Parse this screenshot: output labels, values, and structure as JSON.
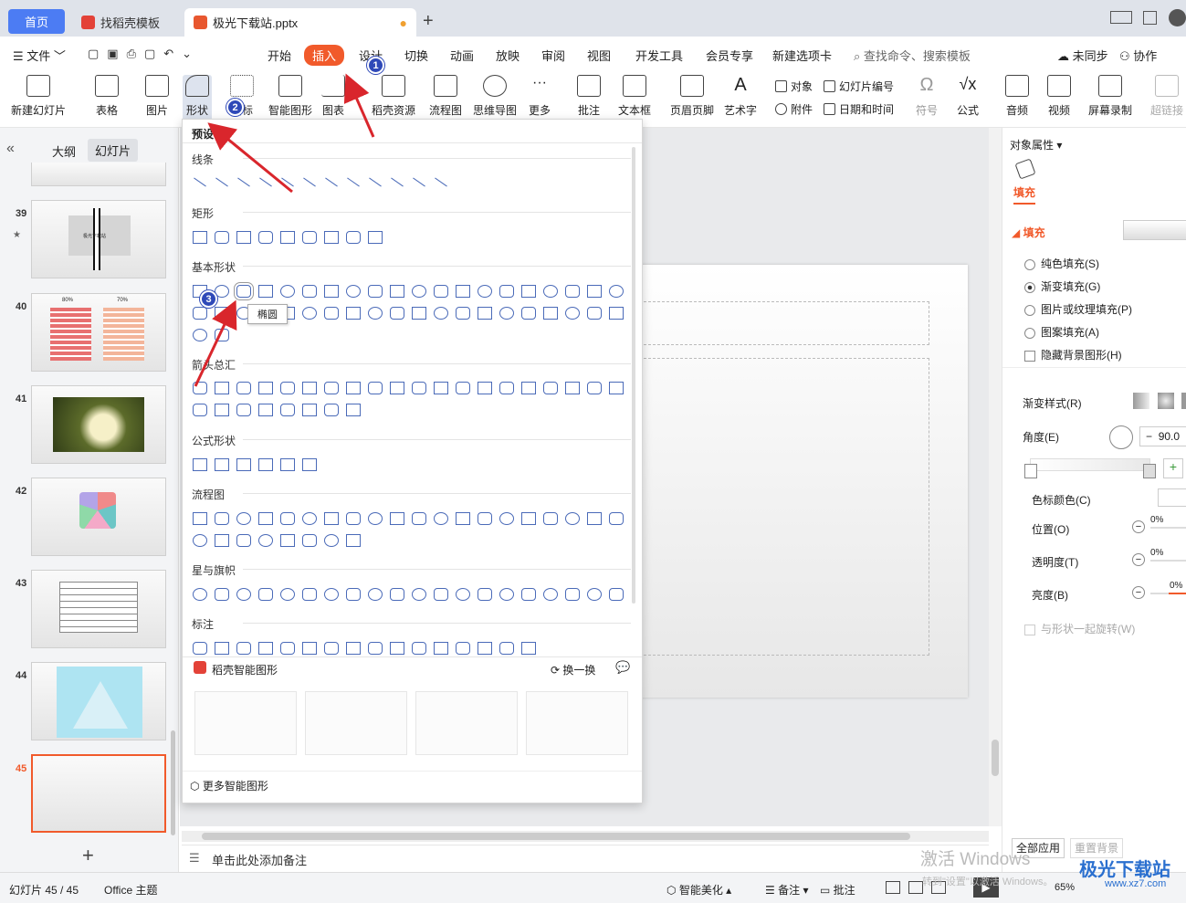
{
  "tabs": {
    "home": "首页",
    "template": "找稻壳模板",
    "file": "极光下载站.pptx"
  },
  "menu": {
    "file": "文件",
    "items": [
      "开始",
      "插入",
      "设计",
      "切换",
      "动画",
      "放映",
      "审阅",
      "视图",
      "开发工具",
      "会员专享",
      "新建选项卡"
    ],
    "search": "查找命令、搜索模板",
    "sync": "未同步",
    "collab": "协作"
  },
  "ribbon": {
    "new_slide": "新建幻灯片",
    "table": "表格",
    "picture": "图片",
    "shape": "形状",
    "icon": "图标",
    "smart": "智能图形",
    "chart": "图表",
    "daoke": "稻壳资源",
    "flow": "流程图",
    "mind": "思维导图",
    "more": "更多",
    "comment": "批注",
    "textbox": "文本框",
    "header": "页眉页脚",
    "art": "艺术字",
    "object": "对象",
    "slide_num": "幻灯片编号",
    "attach": "附件",
    "datetime": "日期和时间",
    "symbol": "符号",
    "formula": "公式",
    "audio": "音频",
    "video": "视频",
    "record": "屏幕录制",
    "link": "超链接"
  },
  "left": {
    "outline": "大纲",
    "slides": "幻灯片",
    "thumbs": [
      "39",
      "40",
      "41",
      "42",
      "43",
      "44",
      "45"
    ],
    "t39_text": "极光下载站",
    "t40_a": "80%",
    "t40_b": "70%"
  },
  "shapes_panel": {
    "header": "预设",
    "sections": [
      "线条",
      "矩形",
      "基本形状",
      "箭头总汇",
      "公式形状",
      "流程图",
      "星与旗帜",
      "标注"
    ],
    "tooltip": "椭圆",
    "smart_title": "稻壳智能图形",
    "refresh": "换一换",
    "more_smart": "更多智能图形"
  },
  "badges": [
    "1",
    "2",
    "3"
  ],
  "notes": "单击此处添加备注",
  "right": {
    "header": "对象属性",
    "tab": "填充",
    "section": "填充",
    "options": [
      "纯色填充(S)",
      "渐变填充(G)",
      "图片或纹理填充(P)",
      "图案填充(A)"
    ],
    "hide_bg": "隐藏背景图形(H)",
    "grad_style": "渐变样式(R)",
    "angle": "角度(E)",
    "angle_val": "90.0",
    "stop_color": "色标颜色(C)",
    "position": "位置(O)",
    "transparency": "透明度(T)",
    "brightness": "亮度(B)",
    "pct": "0%",
    "rotate": "与形状一起旋转(W)",
    "apply_all": "全部应用",
    "reset": "重置背景"
  },
  "status": {
    "slide": "幻灯片 45 / 45",
    "theme": "Office 主题",
    "beautify": "智能美化",
    "notes": "备注",
    "comment": "批注",
    "zoom": "65%",
    "watermark1": "激活 Windows",
    "watermark2": "转到\"设置\"以激活 Windows。",
    "logo": "极光下载站",
    "site": "www.xz7.com"
  },
  "colors": {
    "accent": "#f15a2b",
    "home_tab": "#4c7cf3",
    "badge": "#2f49b8",
    "arrow": "#d9262c"
  }
}
